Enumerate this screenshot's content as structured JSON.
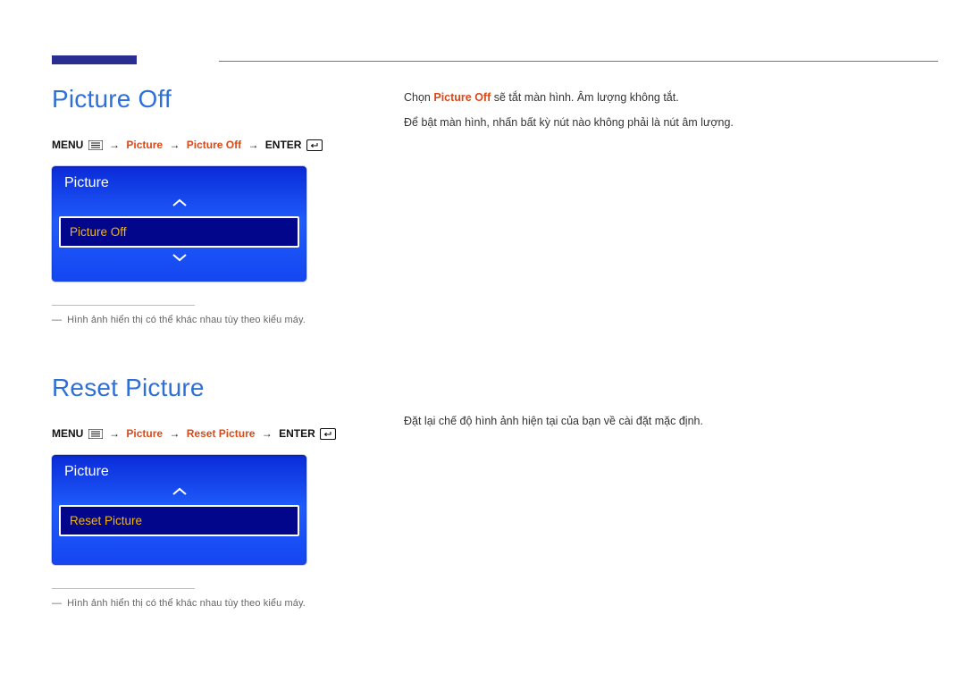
{
  "section1": {
    "heading": "Picture Off",
    "breadcrumb": {
      "menu": "MENU",
      "step1": "Picture",
      "step2": "Picture Off",
      "enter": "ENTER"
    },
    "osd": {
      "title": "Picture",
      "item": "Picture Off"
    },
    "footnote": "Hình ảnh hiển thị có thể khác nhau tùy theo kiểu máy.",
    "description": {
      "line1_pre": "Chọn ",
      "line1_hl": "Picture Off",
      "line1_post": " sẽ tắt màn hình. Âm lượng không tắt.",
      "line2": "Để bật màn hình, nhấn bất kỳ nút nào không phải là nút âm lượng."
    }
  },
  "section2": {
    "heading": "Reset Picture",
    "breadcrumb": {
      "menu": "MENU",
      "step1": "Picture",
      "step2": "Reset Picture",
      "enter": "ENTER"
    },
    "osd": {
      "title": "Picture",
      "item": "Reset Picture"
    },
    "footnote": "Hình ảnh hiển thị có thể khác nhau tùy theo kiểu máy.",
    "description": "Đặt lại chế độ hình ảnh hiện tại của bạn về cài đặt mặc định."
  },
  "glyphs": {
    "arrow": "→",
    "dash": "―"
  }
}
